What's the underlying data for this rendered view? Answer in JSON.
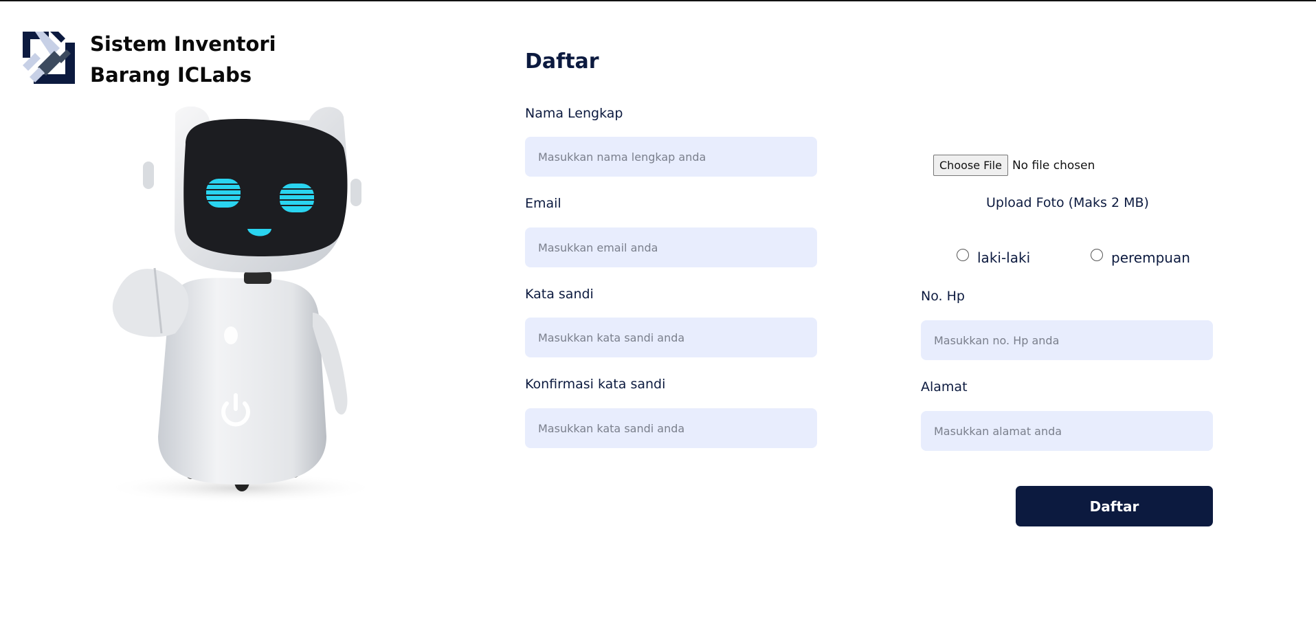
{
  "brand": {
    "title_line1": "Sistem Inventori",
    "title_line2": "Barang ICLabs",
    "logo_icon": "iclabs-logo-icon"
  },
  "illustration": {
    "name": "robot-mascot"
  },
  "form": {
    "title": "Daftar",
    "fields": {
      "full_name": {
        "label": "Nama Lengkap",
        "placeholder": "Masukkan nama lengkap anda",
        "value": ""
      },
      "email": {
        "label": "Email",
        "placeholder": "Masukkan email anda",
        "value": ""
      },
      "password": {
        "label": "Kata sandi",
        "placeholder": "Masukkan kata sandi anda",
        "value": ""
      },
      "password_confirm": {
        "label": "Konfirmasi kata sandi",
        "placeholder": "Masukkan kata sandi anda",
        "value": ""
      },
      "phone": {
        "label": "No. Hp",
        "placeholder": "Masukkan no. Hp anda",
        "value": ""
      },
      "address": {
        "label": "Alamat",
        "placeholder": "Masukkan alamat anda",
        "value": ""
      }
    },
    "upload": {
      "button_label": "Choose File",
      "status": "No file chosen",
      "note": "Upload Foto (Maks 2 MB)"
    },
    "gender": {
      "options": [
        "laki-laki",
        "perempuan"
      ],
      "selected": null
    },
    "submit_label": "Daftar"
  },
  "colors": {
    "primary": "#0c1a3f",
    "input_bg": "#e8edfd",
    "robot_eye": "#2ad4f0"
  }
}
